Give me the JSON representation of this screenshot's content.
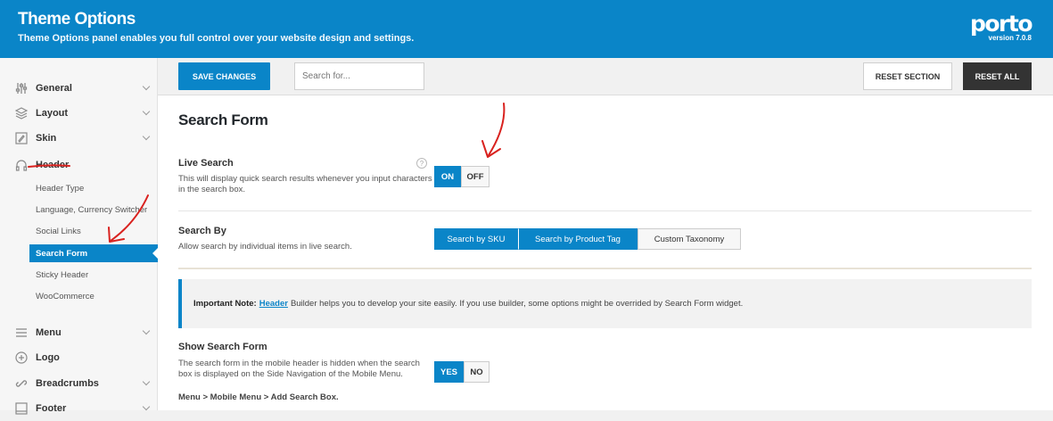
{
  "header": {
    "title": "Theme Options",
    "subtitle": "Theme Options panel enables you full control over your website design and settings.",
    "logo": "porto",
    "version": "version 7.0.8"
  },
  "sidebar": {
    "items": [
      {
        "label": "General",
        "icon": "sliders-icon"
      },
      {
        "label": "Layout",
        "icon": "layers-icon"
      },
      {
        "label": "Skin",
        "icon": "paint-icon"
      },
      {
        "label": "Header",
        "icon": "headphones-icon"
      },
      {
        "label": "Menu",
        "icon": "menu-icon"
      },
      {
        "label": "Logo",
        "icon": "plus-circle-icon"
      },
      {
        "label": "Breadcrumbs",
        "icon": "link-icon"
      },
      {
        "label": "Footer",
        "icon": "footer-icon"
      }
    ],
    "header_subitems": [
      "Header Type",
      "Language, Currency Switcher",
      "Social Links",
      "Search Form",
      "Sticky Header",
      "WooCommerce"
    ],
    "active_subitem": "Search Form"
  },
  "toolbar": {
    "save_label": "SAVE CHANGES",
    "search_placeholder": "Search for...",
    "reset_section_label": "RESET SECTION",
    "reset_all_label": "RESET ALL"
  },
  "main": {
    "section_title": "Search Form",
    "live_search": {
      "title": "Live Search",
      "description": "This will display quick search results whenever you input characters in the search box.",
      "on_label": "ON",
      "off_label": "OFF",
      "selected": "ON"
    },
    "search_by": {
      "title": "Search By",
      "description": "Allow search by individual items in live search.",
      "options": [
        "Search by SKU",
        "Search by Product Tag",
        "Custom Taxonomy"
      ],
      "selected": [
        "Search by SKU",
        "Search by Product Tag"
      ]
    },
    "note": {
      "prefix": "Important Note:",
      "link": "Header",
      "text": "Builder helps you to develop your site easily. If you use builder, some options might be overrided by Search Form widget."
    },
    "show_search_form": {
      "title": "Show Search Form",
      "description": "The search form in the mobile header is hidden when the search box is displayed on the Side Navigation of the Mobile Menu.",
      "path": "Menu > Mobile Menu > Add Search Box.",
      "yes_label": "YES",
      "no_label": "NO",
      "selected": "YES"
    }
  },
  "colors": {
    "accent": "#0a85c8",
    "annotation": "#d9221f",
    "dark_button": "#333333"
  }
}
